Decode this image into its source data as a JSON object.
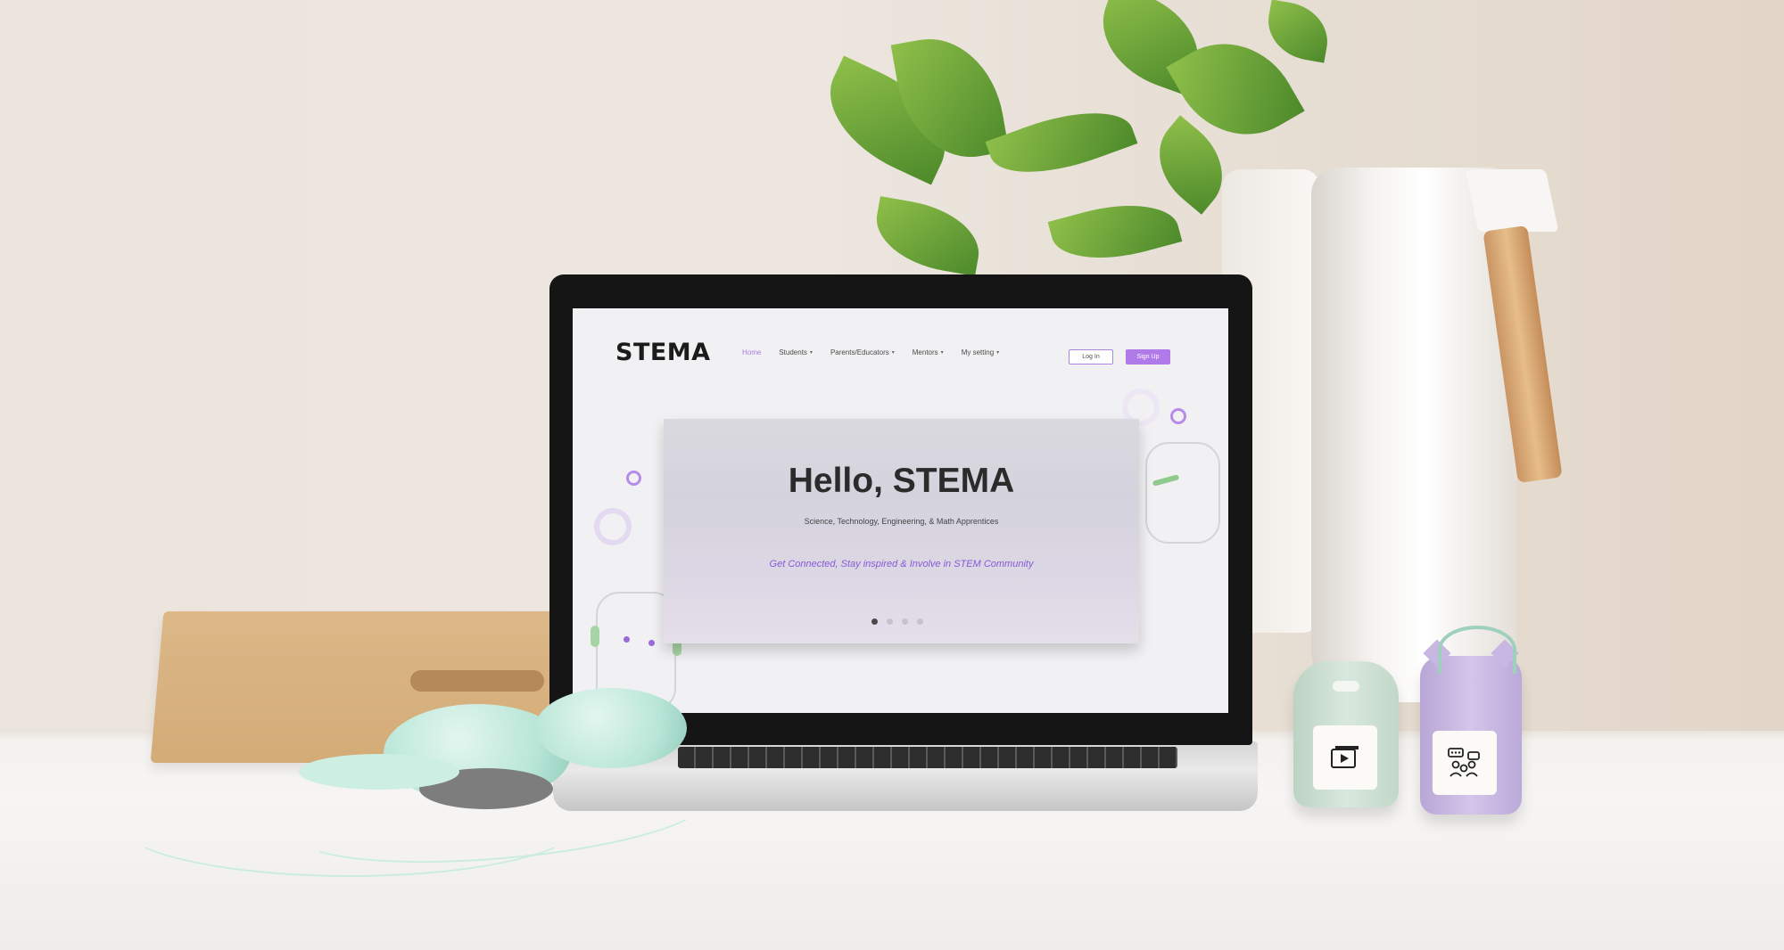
{
  "site": {
    "logo_text": "STEMA",
    "nav": [
      {
        "label": "Home",
        "active": true,
        "has_dropdown": false
      },
      {
        "label": "Students",
        "active": false,
        "has_dropdown": true
      },
      {
        "label": "Parents/Educators",
        "active": false,
        "has_dropdown": true
      },
      {
        "label": "Mentors",
        "active": false,
        "has_dropdown": true
      },
      {
        "label": "My setting",
        "active": false,
        "has_dropdown": true
      }
    ],
    "login_label": "Log In",
    "signup_label": "Sign Up"
  },
  "hero": {
    "title": "Hello, STEMA",
    "subtitle": "Science, Technology, Engineering, & Math Apprentices",
    "tagline": "Get Connected, Stay inspired & Involve in STEM Community",
    "carousel_dots": 4,
    "active_dot": 0
  },
  "colors": {
    "accent": "#a77be0",
    "signup_bg": "#b07ae8",
    "tagline": "#8a59d6",
    "mint_device": "#cfe2d6",
    "lavender_device": "#c9b8e4"
  },
  "devices": [
    {
      "icon": "video-play-icon"
    },
    {
      "icon": "group-chat-icon"
    }
  ]
}
